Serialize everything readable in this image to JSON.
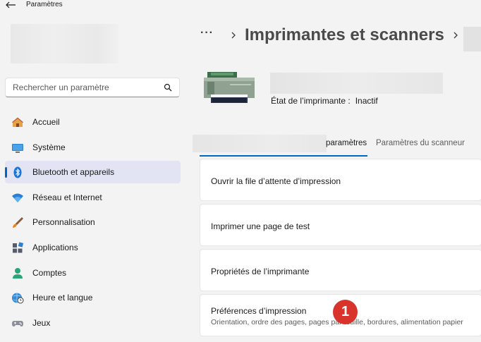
{
  "window": {
    "title": "Paramètres"
  },
  "sidebar": {
    "search": {
      "placeholder": "Rechercher un paramètre"
    },
    "items": [
      {
        "label": "Accueil",
        "icon": "home-icon"
      },
      {
        "label": "Système",
        "icon": "system-icon"
      },
      {
        "label": "Bluetooth et appareils",
        "icon": "bluetooth-icon",
        "active": true
      },
      {
        "label": "Réseau et Internet",
        "icon": "wifi-icon"
      },
      {
        "label": "Personnalisation",
        "icon": "brush-icon"
      },
      {
        "label": "Applications",
        "icon": "apps-icon"
      },
      {
        "label": "Comptes",
        "icon": "account-icon"
      },
      {
        "label": "Heure et langue",
        "icon": "clock-globe-icon"
      },
      {
        "label": "Jeux",
        "icon": "gamepad-icon"
      }
    ]
  },
  "main": {
    "breadcrumb": {
      "more": "···",
      "title": "Imprimantes et scanners"
    },
    "printer": {
      "status_label": "État de l’imprimante :",
      "status_value": "Inactif"
    },
    "tabs": [
      {
        "label": "paramètres",
        "active": true
      },
      {
        "label": "Paramètres du scanneur",
        "active": false
      }
    ],
    "cards": [
      {
        "title": "Ouvrir la file d’attente d’impression"
      },
      {
        "title": "Imprimer une page de test"
      },
      {
        "title": "Propriétés de l’imprimante"
      },
      {
        "title": "Préférences d’impression",
        "subtitle": "Orientation, ordre des pages, pages par feuille, bordures, alimentation papier"
      }
    ]
  },
  "annotation": {
    "badge": "1",
    "color": "#d9342b"
  },
  "colors": {
    "accent": "#0067c0",
    "active_bg": "#e2e3f3",
    "window_bg": "#f3f3f3"
  }
}
